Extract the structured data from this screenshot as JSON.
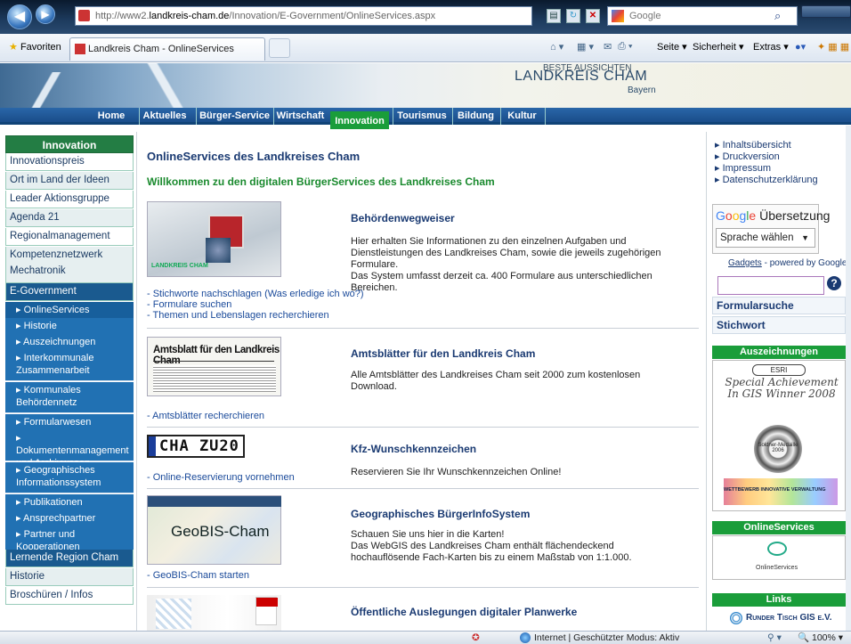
{
  "browser": {
    "url_prefix": "http://www2.",
    "url_host": "landkreis-cham.de",
    "url_path": "/Innovation/E-Government/OnlineServices.aspx",
    "search_placeholder": "Google",
    "favorites_label": "Favoriten",
    "tab_title": "Landkreis Cham - OnlineServices",
    "toolbar": {
      "page": "Seite ▾",
      "security": "Sicherheit ▾",
      "extras": "Extras ▾"
    }
  },
  "banner": {
    "tagline": "Beste Aussichten",
    "name": "LANDKREIS CHAM",
    "region": "Bayern"
  },
  "topnav": {
    "items": [
      "Home",
      "Aktuelles",
      "Bürger-Service",
      "Wirtschaft",
      "Innovation",
      "Tourismus",
      "Bildung",
      "Kultur"
    ],
    "active": "Innovation"
  },
  "leftnav": {
    "header": "Innovation",
    "items": [
      "Innovationspreis",
      "Ort im Land der Ideen",
      "Leader Aktionsgruppe",
      "Agenda 21",
      "Regionalmanagement",
      "Kompetenznetzwerk Mechatronik",
      "E-Government"
    ],
    "sub": [
      "OnlineServices",
      "Historie",
      "Auszeichnungen",
      "Interkommunale Zusammenarbeit",
      "Kommunales Behördennetz",
      "Formularwesen",
      "Dokumentenmanagement und Archivwesen",
      "Geographisches Informationssystem",
      "Publikationen",
      "Ansprechpartner",
      "Partner und Kooperationen"
    ],
    "tail": [
      "Lernende Region Cham",
      "Historie",
      "Broschüren / Infos"
    ]
  },
  "main": {
    "title": "OnlineServices des Landkreises Cham",
    "subtitle": "Willkommen zu den digitalen BürgerServices des Landkreises Cham",
    "s1": {
      "title": "Behördenwegweiser",
      "p1": "Hier erhalten Sie Informationen zu den einzelnen Aufgaben und Dienstleistungen des Landkreises Cham, sowie die jeweils zugehörigen Formulare.",
      "p2": "Das System umfasst derzeit ca. 400 Formulare aus unterschiedlichen Bereichen.",
      "links": [
        "- Stichworte nachschlagen (Was erledige ich wo?)",
        "- Formulare suchen",
        "- Themen und Lebenslagen recherchieren"
      ],
      "img_text": "LANDKREIS CHAM"
    },
    "s2": {
      "title": "Amtsblätter für den Landkreis Cham",
      "p": "Alle Amtsblätter des Landkreises Cham seit 2000 zum kostenlosen Download.",
      "link": "- Amtsblätter recherchieren",
      "img_text": "Amtsblatt für den Landkreis Cham"
    },
    "s3": {
      "title": "Kfz-Wunschkennzeichen",
      "p": "Reservieren Sie Ihr Wunschkennzeichen Online!",
      "link": "- Online-Reservierung vornehmen",
      "plate": "CHA ZU20"
    },
    "s4": {
      "title": "Geographisches BürgerInfoSystem",
      "p1": "Schauen Sie uns hier in die Karten!",
      "p2": "Das WebGIS des Landkreises Cham enthält flächendeckend hochauflösende Fach-Karten bis zu einem Maßstab von 1:1.000.",
      "link": "- GeoBIS-Cham starten",
      "img_text": "GeoBIS-Cham"
    },
    "s5": {
      "title": "Öffentliche Auslegungen digitaler Planwerke"
    }
  },
  "right": {
    "links": [
      "Inhaltsübersicht",
      "Druckversion",
      "Impressum",
      "Datenschutzerklärung"
    ],
    "translate_title": "Übersetzung",
    "translate_select": "Sprache wählen",
    "gadgets": "Gadgets",
    "powered": " - powered by Google",
    "search_help": "?",
    "formsearch": "Formularsuche",
    "keyword": "Stichwort",
    "awards": "Auszeichnungen",
    "esri": "Special Achievement In GIS Winner 2008",
    "esri_logo": "ESRI",
    "soldner": "Soldner-Medaille 2006",
    "wettbewerb": "WETTBEWERB INNOVATIVE VERWALTUNG",
    "online_hdr": "OnlineServices",
    "online_label": "OnlineServices",
    "links_hdr": "Links",
    "runder": "Runder Tisch GIS e.V."
  },
  "status": {
    "text": "Internet | Geschützter Modus: Aktiv",
    "zoom": "100%"
  }
}
